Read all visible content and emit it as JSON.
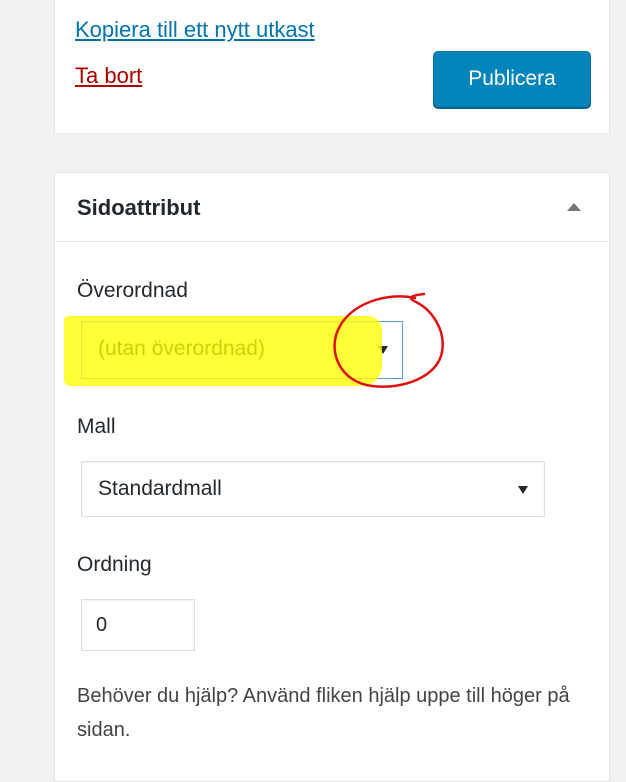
{
  "publish_box": {
    "copy_link": "Kopiera till ett nytt utkast",
    "delete_link": "Ta bort",
    "publish_button": "Publicera"
  },
  "page_attributes": {
    "title": "Sidoattribut",
    "parent_label": "Överordnad",
    "parent_value": "(utan överordnad)",
    "template_label": "Mall",
    "template_value": "Standardmall",
    "order_label": "Ordning",
    "order_value": "0",
    "help_text": "Behöver du hjälp? Använd fliken hjälp uppe till höger på sidan."
  },
  "colors": {
    "link": "#0073aa",
    "delete": "#a00000",
    "primary_button": "#0085ba",
    "highlight": "#ffff00",
    "annotation_circle": "#e01010"
  },
  "icons": {
    "toggle": "triangle-up-icon",
    "select_arrow": "dropdown-arrow-icon"
  }
}
